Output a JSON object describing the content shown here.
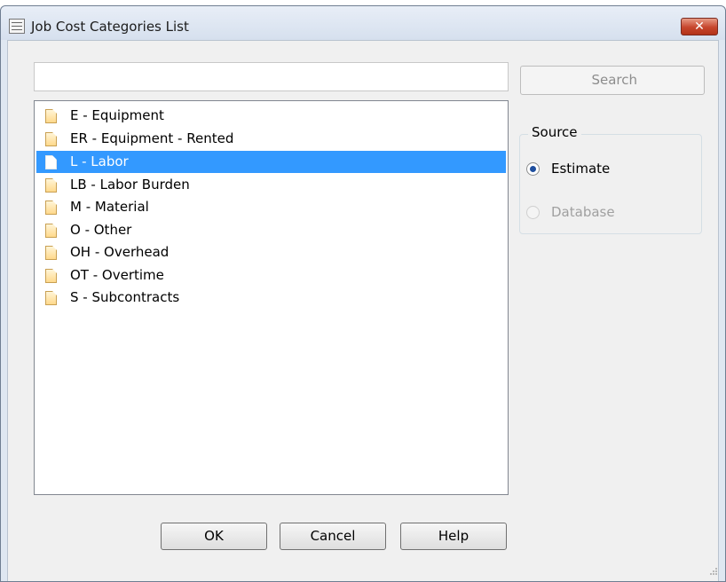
{
  "window": {
    "title": "Job Cost Categories List",
    "close_symbol": "✕",
    "icon": "list-window-icon"
  },
  "search": {
    "input_value": "",
    "button_label": "Search"
  },
  "categories": [
    {
      "label": "E - Equipment",
      "selected": false
    },
    {
      "label": "ER - Equipment - Rented",
      "selected": false
    },
    {
      "label": "L - Labor",
      "selected": true
    },
    {
      "label": "LB - Labor Burden",
      "selected": false
    },
    {
      "label": "M - Material",
      "selected": false
    },
    {
      "label": "O - Other",
      "selected": false
    },
    {
      "label": "OH - Overhead",
      "selected": false
    },
    {
      "label": "OT - Overtime",
      "selected": false
    },
    {
      "label": "S - Subcontracts",
      "selected": false
    }
  ],
  "source": {
    "legend": "Source",
    "options": [
      {
        "label": "Estimate",
        "checked": true,
        "enabled": true
      },
      {
        "label": "Database",
        "checked": false,
        "enabled": false
      }
    ]
  },
  "buttons": {
    "ok": "OK",
    "cancel": "Cancel",
    "help": "Help"
  },
  "colors": {
    "selection": "#3399ff",
    "close_button": "#c6452c"
  }
}
